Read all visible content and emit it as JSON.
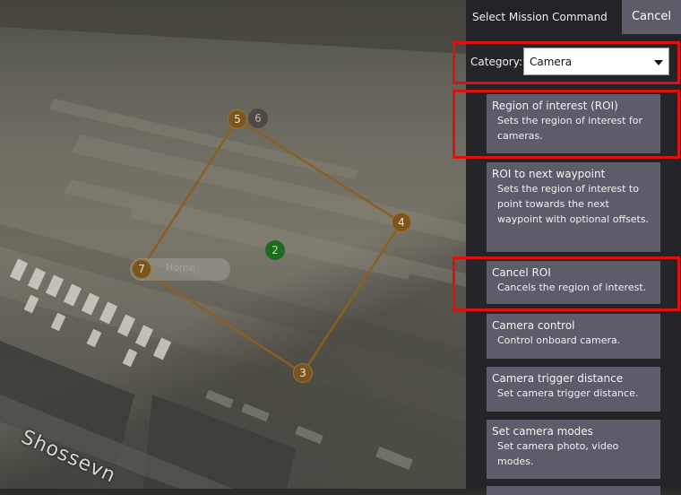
{
  "map": {
    "waypoints": [
      {
        "label": "5",
        "kind": "mission"
      },
      {
        "label": "6",
        "kind": "ghost"
      },
      {
        "label": "4",
        "kind": "mission"
      },
      {
        "label": "3",
        "kind": "mission"
      },
      {
        "label": "7",
        "kind": "mission"
      },
      {
        "label": "2",
        "kind": "current"
      }
    ],
    "home_label": "Home",
    "street_label": "Shossevn",
    "colors": {
      "mission_path": "#8a5f22",
      "current": "#1e6b1e"
    }
  },
  "panel": {
    "title": "Select Mission Command",
    "cancel_label": "Cancel",
    "category": {
      "label": "Category:",
      "value": "Camera",
      "caret_icon": "chevron-down-icon"
    },
    "commands": [
      {
        "title": "Region of interest (ROI)",
        "description": "Sets the region of interest for cameras."
      },
      {
        "title": "ROI to next waypoint",
        "description": "Sets the region of interest to point towards the next waypoint with optional offsets."
      },
      {
        "title": "Cancel ROI",
        "description": "Cancels the region of interest."
      },
      {
        "title": "Camera control",
        "description": "Control onboard camera."
      },
      {
        "title": "Camera trigger distance",
        "description": "Set camera trigger distance."
      },
      {
        "title": "Set camera modes",
        "description": "Set camera photo, video modes."
      }
    ],
    "highlight_color": "#e01010"
  }
}
